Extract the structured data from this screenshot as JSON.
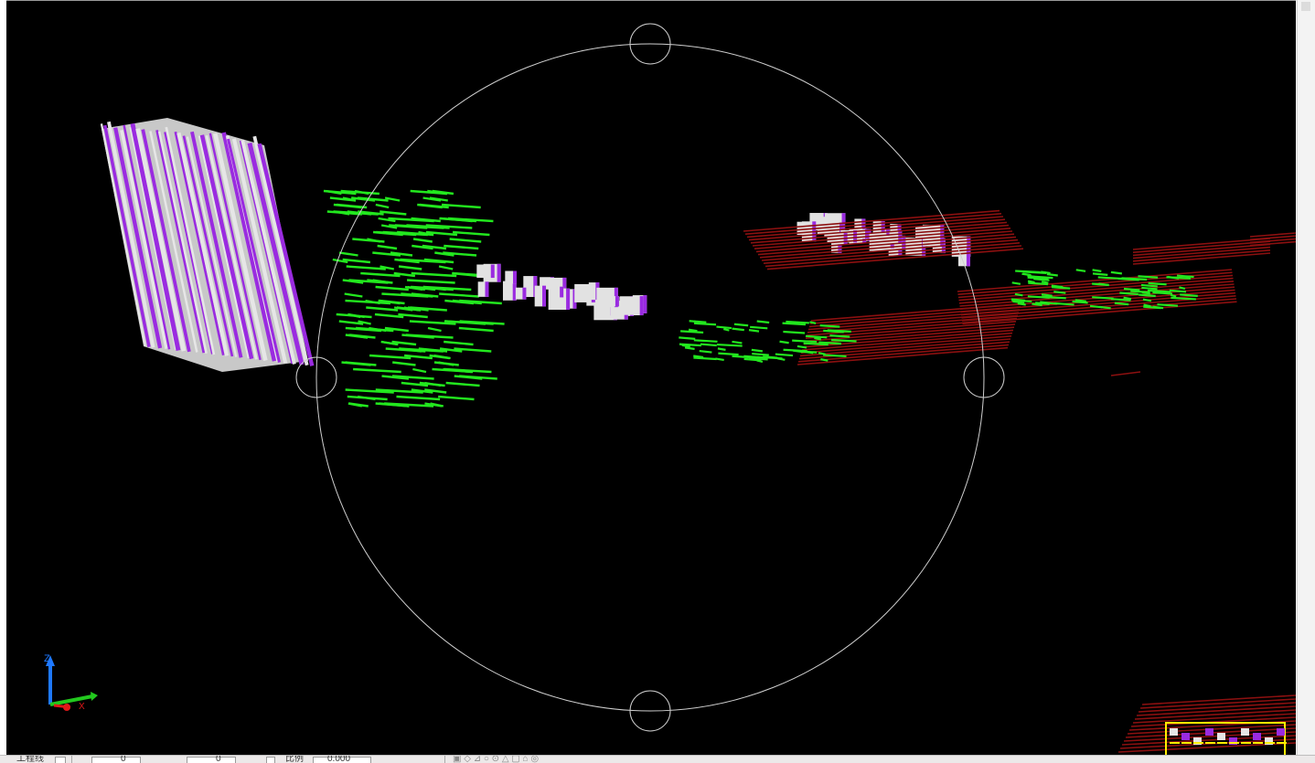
{
  "viewport": {
    "background": "#000000",
    "colors": {
      "tower_face": "#c8c8c8",
      "tower_accent": "#9a2be0",
      "green_layer": "#22e81e",
      "red_layer": "#8c1010",
      "yellow_layer": "#ffee00",
      "orbit_ring": "#cfcfcf"
    },
    "orbit_tool": {
      "ring": "orbit-ring",
      "handles": [
        "orbit-handle-top",
        "orbit-handle-left",
        "orbit-handle-right",
        "orbit-handle-bottom"
      ]
    }
  },
  "ucs_icon": {
    "z_label": "Z",
    "x_label": "X",
    "z_color": "#1e78ff",
    "y_color": "#22c81e",
    "x_color": "#e01818"
  },
  "statusbar": {
    "layer_label": "工程线",
    "field1_value": "0",
    "field2_value": "0",
    "scale_label": "比例",
    "scale_value": "0.000"
  }
}
